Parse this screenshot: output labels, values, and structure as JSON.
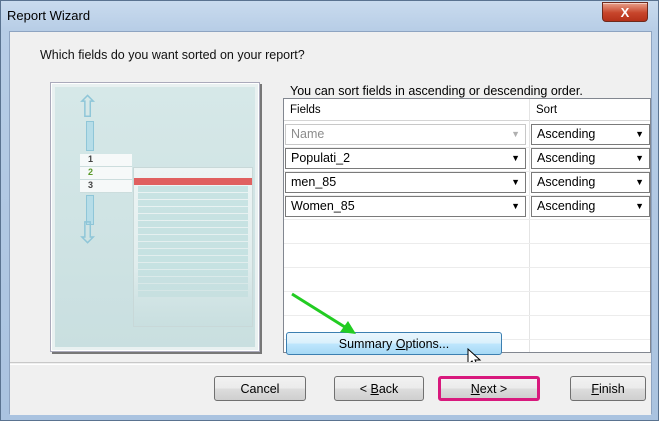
{
  "window": {
    "title": "Report Wizard",
    "close_label": "X"
  },
  "question": "Which fields do you want sorted on your report?",
  "hint": "You can sort fields in ascending or descending order.",
  "illustration": {
    "levels": [
      "1",
      "2",
      "3"
    ]
  },
  "grid": {
    "headers": {
      "fields": "Fields",
      "sort": "Sort"
    },
    "rows": [
      {
        "field": "Name",
        "sort": "Ascending",
        "field_disabled": true
      },
      {
        "field": "Populati_2",
        "sort": "Ascending"
      },
      {
        "field": "men_85",
        "sort": "Ascending"
      },
      {
        "field": "Women_85",
        "sort": "Ascending"
      }
    ]
  },
  "buttons": {
    "summary_prefix": "Summary ",
    "summary_mnemonic": "O",
    "summary_suffix": "ptions...",
    "cancel": "Cancel",
    "back_prefix": "< ",
    "back_mnemonic": "B",
    "back_suffix": "ack",
    "next_mnemonic": "N",
    "next_suffix": "ext >",
    "finish_mnemonic": "F",
    "finish_suffix": "inish"
  },
  "colors": {
    "highlight": "#d8197d",
    "annotation_arrow": "#22cc22"
  }
}
